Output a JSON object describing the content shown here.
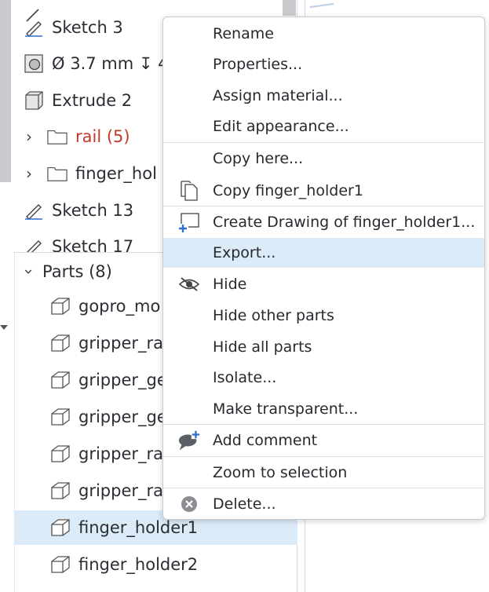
{
  "feature_tree": {
    "items": [
      {
        "label": "Sketch 3",
        "icon": "sketch-icon"
      },
      {
        "label": "Ø 3.7 mm ↧ 4",
        "icon": "hole-icon"
      },
      {
        "label": "Extrude 2",
        "icon": "extrude-icon"
      },
      {
        "label": "rail (5)",
        "icon": "folder-icon",
        "color": "#c0392b"
      },
      {
        "label": "finger_hol",
        "icon": "folder-icon"
      },
      {
        "label": "Sketch 13",
        "icon": "sketch-icon"
      },
      {
        "label": "Sketch 17",
        "icon": "sketch-icon"
      }
    ]
  },
  "parts": {
    "header": "Parts (8)",
    "items": [
      {
        "label": "gopro_mo"
      },
      {
        "label": "gripper_ra"
      },
      {
        "label": "gripper_ge"
      },
      {
        "label": "gripper_ge"
      },
      {
        "label": "gripper_ra"
      },
      {
        "label": "gripper_ra"
      },
      {
        "label": "finger_holder1",
        "selected": true
      },
      {
        "label": "finger_holder2"
      }
    ]
  },
  "context_menu": {
    "items": [
      {
        "label": "Rename"
      },
      {
        "label": "Properties..."
      },
      {
        "label": "Assign material..."
      },
      {
        "label": "Edit appearance..."
      },
      {
        "label": "Copy here..."
      },
      {
        "label": "Copy finger_holder1",
        "icon": "copy-icon"
      },
      {
        "label": "Create Drawing of finger_holder1...",
        "icon": "create-drawing-icon"
      },
      {
        "label": "Export...",
        "highlighted": true
      },
      {
        "label": "Hide",
        "icon": "hide-eye-icon"
      },
      {
        "label": "Hide other parts"
      },
      {
        "label": "Hide all parts"
      },
      {
        "label": "Isolate..."
      },
      {
        "label": "Make transparent..."
      },
      {
        "label": "Add comment",
        "icon": "add-comment-icon"
      },
      {
        "label": "Zoom to selection"
      },
      {
        "label": "Delete...",
        "icon": "delete-icon"
      }
    ]
  },
  "colors": {
    "selection": "#dcebf8",
    "accent_blue": "#2f6fd0",
    "rail_red": "#c0392b"
  }
}
